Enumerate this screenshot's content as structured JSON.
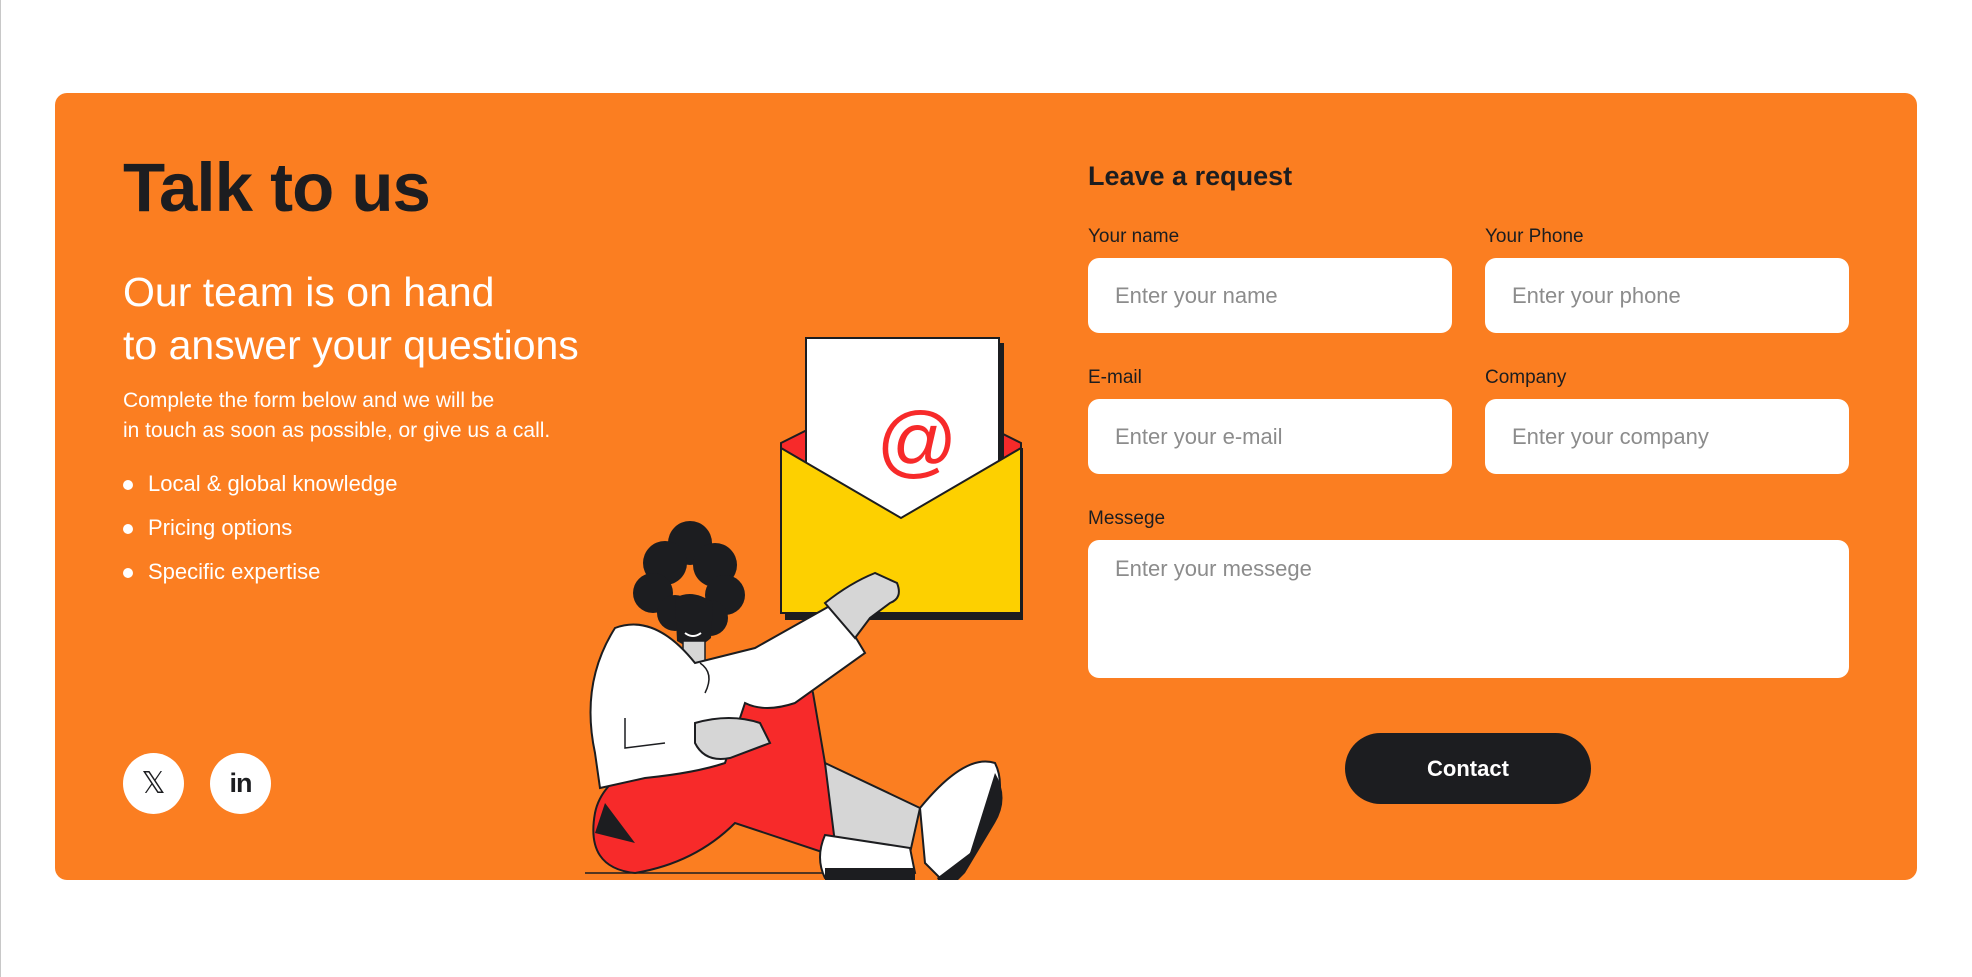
{
  "hero": {
    "title": "Talk to us",
    "subtitle_line1": "Our team is on hand",
    "subtitle_line2": "to answer your questions",
    "description_line1": "Complete the form below and we will be",
    "description_line2": "in touch as soon as possible, or give us a call.",
    "bullets": [
      "Local & global knowledge",
      "Pricing options",
      "Specific expertise"
    ]
  },
  "social": {
    "x_glyph": "𝕏",
    "linkedin_glyph": "in",
    "icons": [
      "x-icon",
      "linkedin-icon"
    ]
  },
  "illustration": {
    "envelope_symbol": "@"
  },
  "form": {
    "title": "Leave a request",
    "name_label": "Your name",
    "name_placeholder": "Enter your name",
    "phone_label": "Your Phone",
    "phone_placeholder": "Enter your phone",
    "email_label": "E-mail",
    "email_placeholder": "Enter your e-mail",
    "company_label": "Company",
    "company_placeholder": "Enter your company",
    "message_label": "Messege",
    "message_placeholder": "Enter your messege",
    "submit_label": "Contact"
  },
  "colors": {
    "card_bg": "#fb7e21",
    "dark": "#1c1d20",
    "envelope": "#fdd000",
    "accent_red": "#f72a2a",
    "white": "#ffffff"
  }
}
